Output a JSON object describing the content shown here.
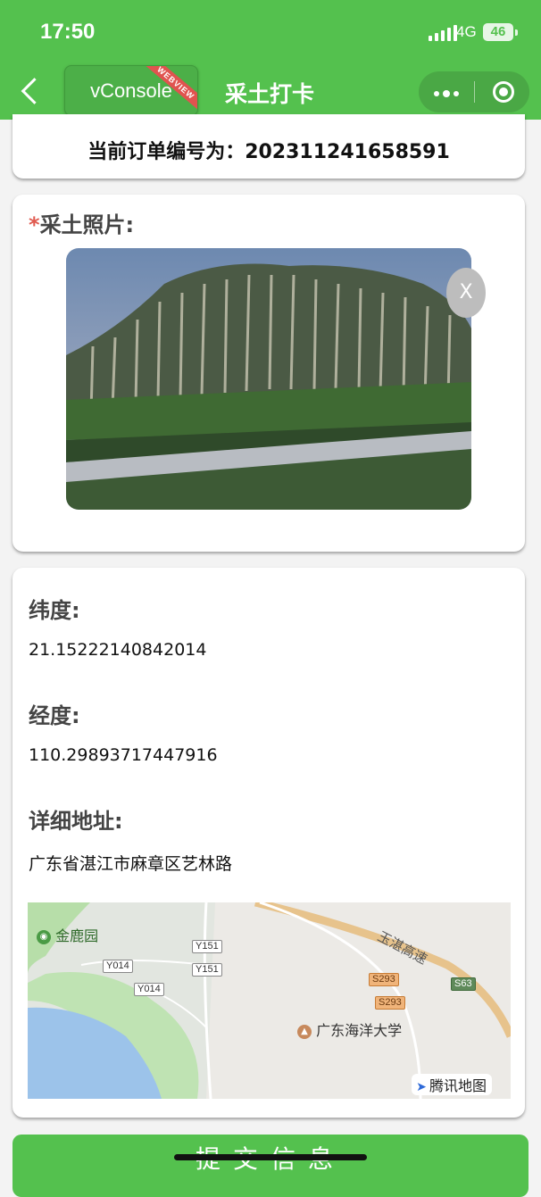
{
  "status_bar": {
    "time": "17:50",
    "network": "4G",
    "battery": "46"
  },
  "nav": {
    "vconsole_label": "vConsole",
    "vconsole_ribbon": "WEBVIEW",
    "title": "采土打卡"
  },
  "order": {
    "text": "当前订单编号为：202311241658591"
  },
  "photo_section": {
    "required_mark": "*",
    "label": "采土照片:",
    "close_label": "X"
  },
  "location": {
    "latitude_label": "纬度:",
    "latitude_value": "21.15222140842014",
    "longitude_label": "经度:",
    "longitude_value": "110.29893717447916",
    "address_label": "详细地址:",
    "address_value": "广东省湛江市麻章区艺林路"
  },
  "map": {
    "poi_park": "金鹿园",
    "poi_university": "广东海洋大学",
    "highway": "玉湛高速",
    "roads": [
      "Y151",
      "Y151",
      "Y014",
      "Y014",
      "S293",
      "S293",
      "S63"
    ],
    "attribution": "腾讯地图"
  },
  "submit": {
    "label": "提交信息"
  },
  "colors": {
    "brand": "#54c14e",
    "required": "#e05a4f"
  }
}
